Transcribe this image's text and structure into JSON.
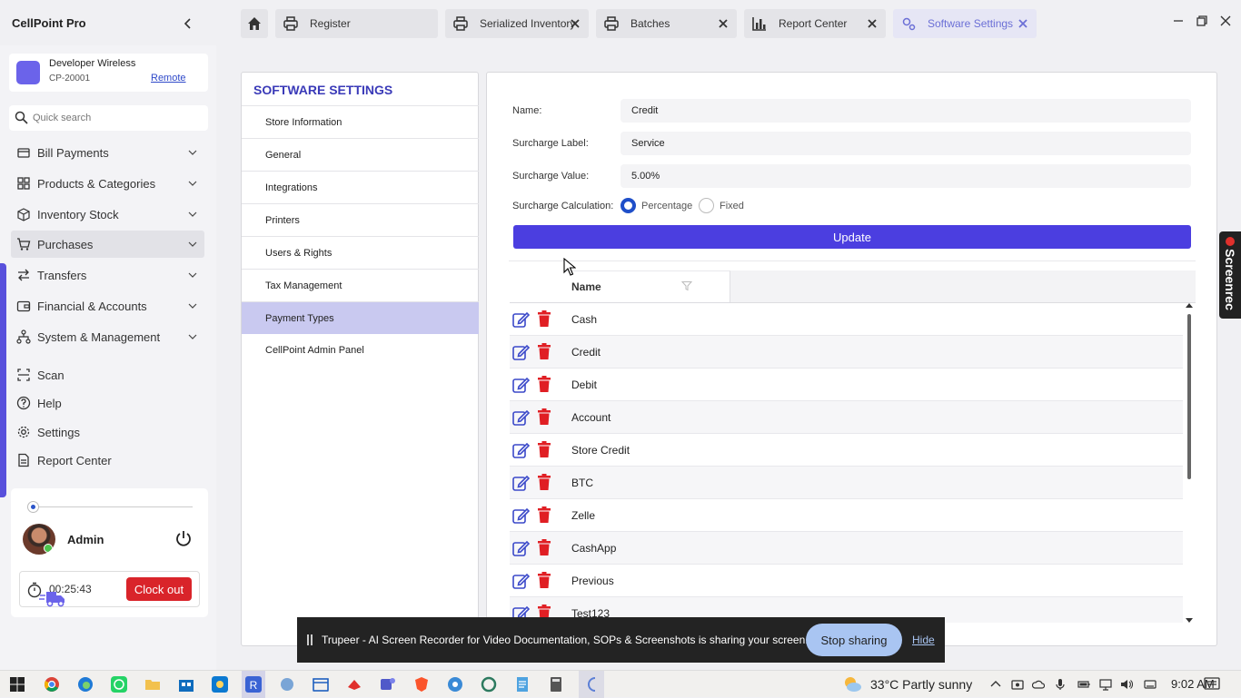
{
  "app": {
    "title": "CellPoint Pro"
  },
  "tabs": [
    {
      "label": "Register"
    },
    {
      "label": "Serialized Inventory"
    },
    {
      "label": "Batches"
    },
    {
      "label": "Report Center"
    },
    {
      "label": "Software Settings"
    }
  ],
  "store": {
    "name": "Developer Wireless",
    "code": "CP-20001",
    "remote_label": "Remote"
  },
  "search": {
    "placeholder": "Quick search"
  },
  "nav": {
    "groups": [
      {
        "label": "Bill Payments"
      },
      {
        "label": "Products & Categories"
      },
      {
        "label": "Inventory Stock"
      },
      {
        "label": "Purchases"
      },
      {
        "label": "Transfers"
      },
      {
        "label": "Financial & Accounts"
      },
      {
        "label": "System & Management"
      }
    ],
    "links": [
      {
        "label": "Scan"
      },
      {
        "label": "Help"
      },
      {
        "label": "Settings"
      },
      {
        "label": "Report Center"
      }
    ]
  },
  "user": {
    "name": "Admin",
    "timer": "00:25:43",
    "clockout_label": "Clock out"
  },
  "settings": {
    "title": "SOFTWARE SETTINGS",
    "menu": [
      {
        "label": "Store Information"
      },
      {
        "label": "General"
      },
      {
        "label": "Integrations"
      },
      {
        "label": "Printers"
      },
      {
        "label": "Users & Rights"
      },
      {
        "label": "Tax Management"
      },
      {
        "label": "Payment Types"
      },
      {
        "label": "CellPoint Admin Panel"
      }
    ],
    "selected": "Payment Types"
  },
  "form": {
    "name_label": "Name:",
    "name_value": "Credit",
    "surcharge_label_label": "Surcharge Label:",
    "surcharge_label_value": "Service",
    "surcharge_value_label": "Surcharge Value:",
    "surcharge_value_value": "5.00%",
    "calc_label": "Surcharge Calculation:",
    "calc_options": [
      "Percentage",
      "Fixed"
    ],
    "calc_selected": "Percentage",
    "update_label": "Update"
  },
  "grid": {
    "column_name": "Name",
    "rows": [
      "Cash",
      "Credit",
      "Debit",
      "Account",
      "Store Credit",
      "BTC",
      "Zelle",
      "CashApp",
      "Previous",
      "Test123"
    ]
  },
  "overlay": {
    "screenrec_label": "Screenrec",
    "share_text": "Trupeer - AI Screen Recorder for Video Documentation, SOPs & Screenshots is sharing your screen.",
    "stop_label": "Stop sharing",
    "hide_label": "Hide"
  },
  "taskbar": {
    "weather": "33°C  Partly sunny",
    "time": "9:02 AM"
  },
  "colors": {
    "accent": "#4b3ee0",
    "danger": "#d9242a",
    "selected_menu": "#c9c9f0",
    "link": "#2f49c9"
  }
}
